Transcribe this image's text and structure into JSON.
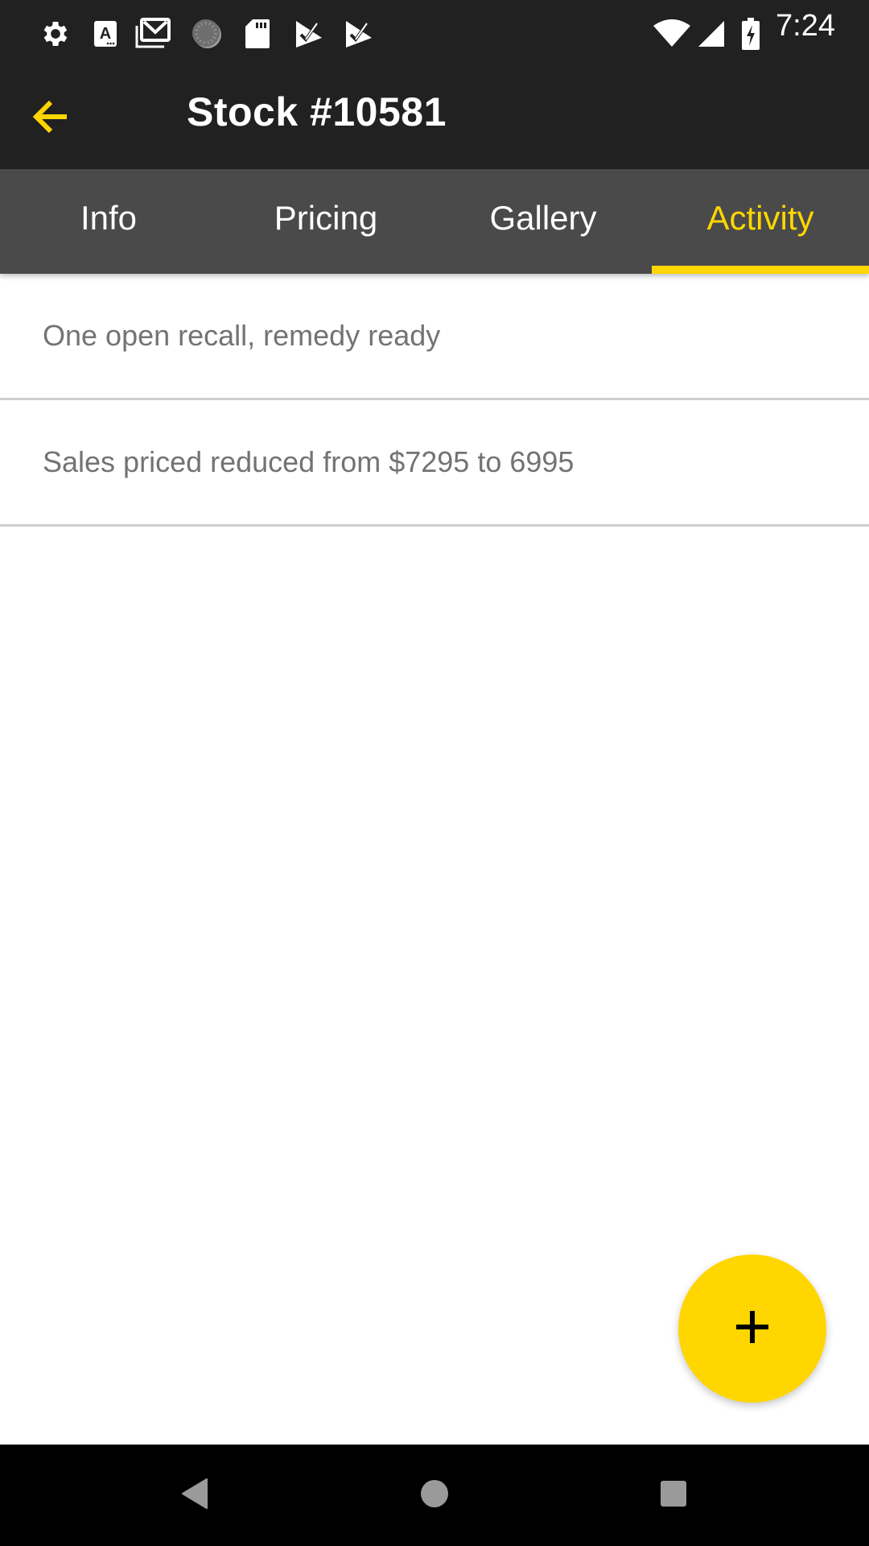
{
  "status_bar": {
    "time": "7:24",
    "left_icons": [
      "settings-icon",
      "accessibility-a-icon",
      "gmail-icon",
      "sync-progress-icon",
      "sd-card-icon",
      "play-store-check-icon",
      "play-store-check-icon"
    ],
    "right_icons": [
      "wifi-icon",
      "cell-signal-icon",
      "battery-charging-icon"
    ]
  },
  "app_bar": {
    "back_icon": "arrow-back-icon",
    "title": "Stock #10581"
  },
  "tabs": [
    {
      "label": "Info",
      "active": false
    },
    {
      "label": "Pricing",
      "active": false
    },
    {
      "label": "Gallery",
      "active": false
    },
    {
      "label": "Activity",
      "active": true
    }
  ],
  "activity": {
    "items": [
      {
        "text": "One open recall, remedy ready"
      },
      {
        "text": "Sales priced reduced from $7295 to 6995"
      }
    ]
  },
  "fab": {
    "icon": "plus-icon"
  },
  "nav_bar": {
    "buttons": [
      "back-triangle-icon",
      "home-circle-icon",
      "recents-square-icon"
    ]
  },
  "colors": {
    "accent": "#ffd600",
    "app_bar_bg": "#212121",
    "tab_bar_bg": "#4a4a4a",
    "list_text": "#737373",
    "divider": "#cfcfcf",
    "nav_bar_bg": "#000000"
  }
}
